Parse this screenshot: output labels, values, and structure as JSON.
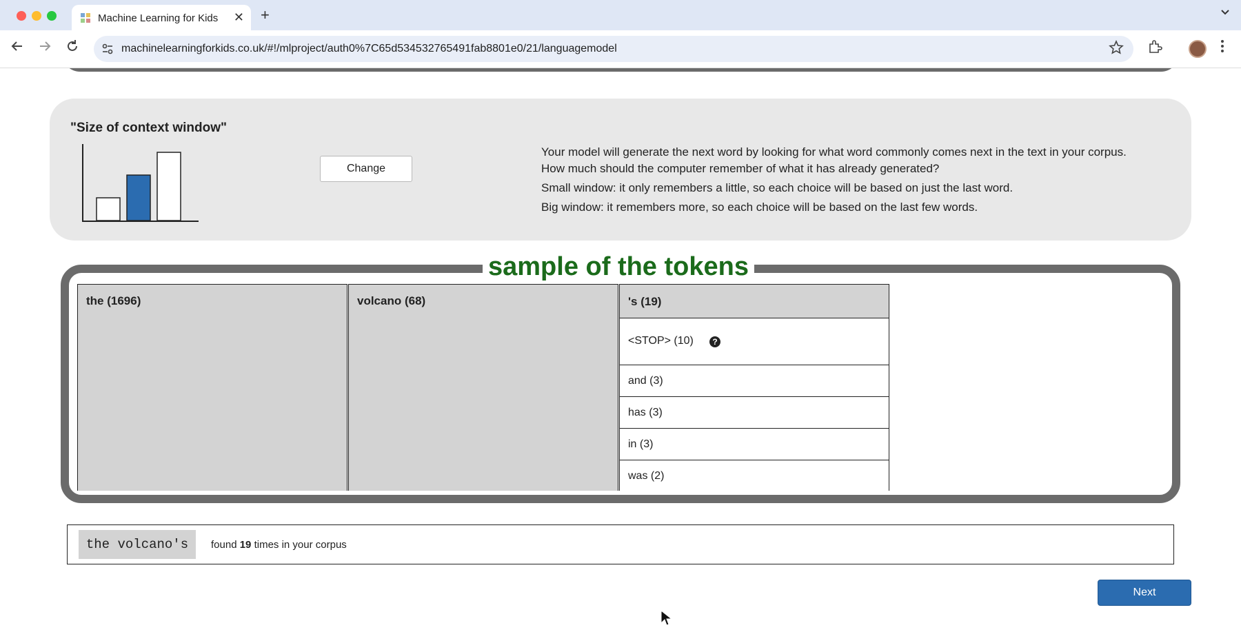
{
  "browser": {
    "tab_title": "Machine Learning for Kids",
    "new_tab": "+",
    "tab_close": "✕",
    "url": "machinelearningforkids.co.uk/#!/mlproject/auth0%7C65d534532765491fab8801e0/21/languagemodel"
  },
  "context_panel": {
    "title": "\"Size of context window\"",
    "change_label": "Change",
    "context_levels": [
      "small",
      "medium",
      "large"
    ],
    "selected_level": "medium",
    "description": [
      "Your model will generate the next word by looking for what word commonly comes next in the text in your corpus.",
      "How much should the computer remember of what it has already generated?",
      "Small window: it only remembers a little, so each choice will be based on just the last word.",
      "Big window: it remembers more, so each choice will be based on the last few words."
    ],
    "colors": {
      "selected_bar": "#2b6cb0",
      "panel_bg": "#e8e8e8"
    }
  },
  "tokens": {
    "title": "sample of the tokens",
    "title_color": "#1b6b1b",
    "columns": [
      {
        "header": "the (1696)"
      },
      {
        "header": "volcano (68)"
      },
      {
        "header": "'s (19)",
        "rows": [
          {
            "label": "<STOP> (10)",
            "help_icon": "question-circle-icon"
          },
          {
            "label": "and (3)"
          },
          {
            "label": "has (3)"
          },
          {
            "label": "in (3)"
          },
          {
            "label": "was (2)"
          }
        ]
      }
    ]
  },
  "found": {
    "phrase": "the volcano's",
    "prefix": "found",
    "count": "19",
    "suffix": "times in your corpus"
  },
  "next_label": "Next"
}
